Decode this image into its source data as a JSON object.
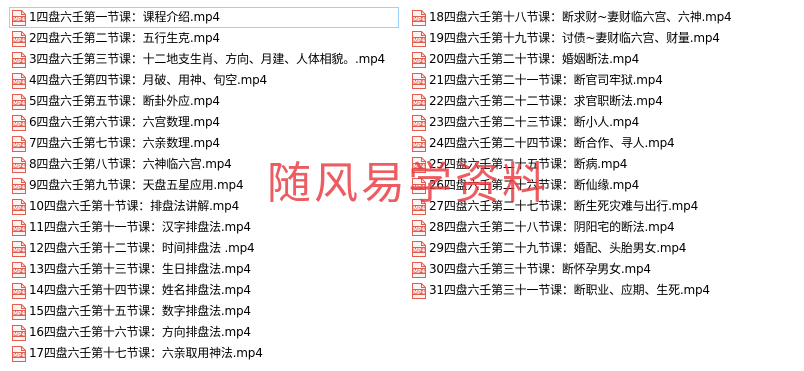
{
  "files_left": [
    "1四盘六壬第一节课：课程介绍.mp4",
    "2四盘六壬第二节课：五行生克.mp4",
    "3四盘六壬第三节课：十二地支生肖、方向、月建、人体相貌。.mp4",
    "4四盘六壬第四节课：月破、用神、旬空.mp4",
    "5四盘六壬第五节课：断卦外应.mp4",
    "6四盘六壬第六节课：六宫数理.mp4",
    "7四盘六壬第七节课：六亲数理.mp4",
    "8四盘六壬第八节课：六神临六宫.mp4",
    "9四盘六壬第九节课：天盘五星应用.mp4",
    "10四盘六壬第十节课：排盘法讲解.mp4",
    "11四盘六壬第十一节课：汉字排盘法.mp4",
    "12四盘六壬第十二节课：时间排盘法 .mp4",
    "13四盘六壬第十三节课：生日排盘法.mp4",
    "14四盘六壬第十四节课：姓名排盘法.mp4",
    "15四盘六壬第十五节课：数字排盘法.mp4",
    "16四盘六壬第十六节课：方向排盘法.mp4",
    "17四盘六壬第十七节课：六亲取用神法.mp4"
  ],
  "files_right": [
    "18四盘六壬第十八节课：断求财~妻财临六宫、六神.mp4",
    "19四盘六壬第十九节课：讨债~妻财临六宫、财量.mp4",
    "20四盘六壬第二十节课：婚姻断法.mp4",
    "21四盘六壬第二十一节课：断官司牢狱.mp4",
    "22四盘六壬第二十二节课：求官职断法.mp4",
    "23四盘六壬第二十三节课：断小人.mp4",
    "24四盘六壬第二十四节课：断合作、寻人.mp4",
    "25四盘六壬第二十五节课：断病.mp4",
    "26四盘六壬第二十六节课：断仙缘.mp4",
    "27四盘六壬第二十七节课：断生死灾难与出行.mp4",
    "28四盘六壬第二十八节课：阴阳宅的断法.mp4",
    "29四盘六壬第二十九节课：婚配、头胎男女.mp4",
    "30四盘六壬第三十节课：断怀孕男女.mp4",
    "31四盘六壬第三十一节课：断职业、应期、生死.mp4"
  ],
  "icon": {
    "name": "mp4-file-icon",
    "label": "MP4",
    "color": "#e35d4f"
  },
  "selected_index": 0,
  "watermark": "随风易学资料"
}
